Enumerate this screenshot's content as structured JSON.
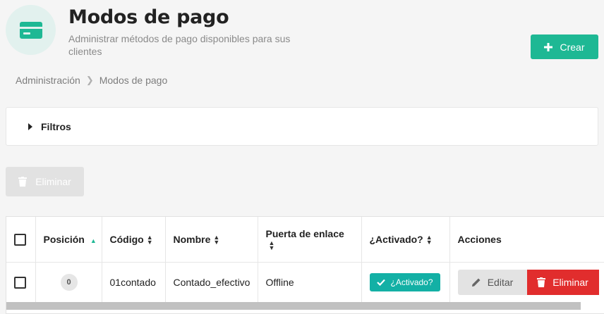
{
  "header": {
    "title": "Modos de pago",
    "subtitle": "Administrar métodos de pago disponibles para sus clientes",
    "icon": "credit-card-icon"
  },
  "actions": {
    "create_label": "Crear",
    "bulk_delete_label": "Eliminar"
  },
  "breadcrumb": {
    "items": [
      "Administración",
      "Modos de pago"
    ]
  },
  "filters": {
    "label": "Filtros"
  },
  "table": {
    "columns": [
      "Posición",
      "Código",
      "Nombre",
      "Puerta de enlace",
      "¿Activado?",
      "Acciones"
    ],
    "rows": [
      {
        "position": "0",
        "code": "01contado",
        "name": "Contado_efectivo",
        "gateway": "Offline",
        "active_label": "¿Activado?",
        "edit_label": "Editar",
        "delete_label": "Eliminar"
      }
    ]
  },
  "colors": {
    "accent": "#1eb894",
    "active": "#13b0a5",
    "danger": "#e12d2d",
    "icon_bg": "#e2f1ee"
  }
}
